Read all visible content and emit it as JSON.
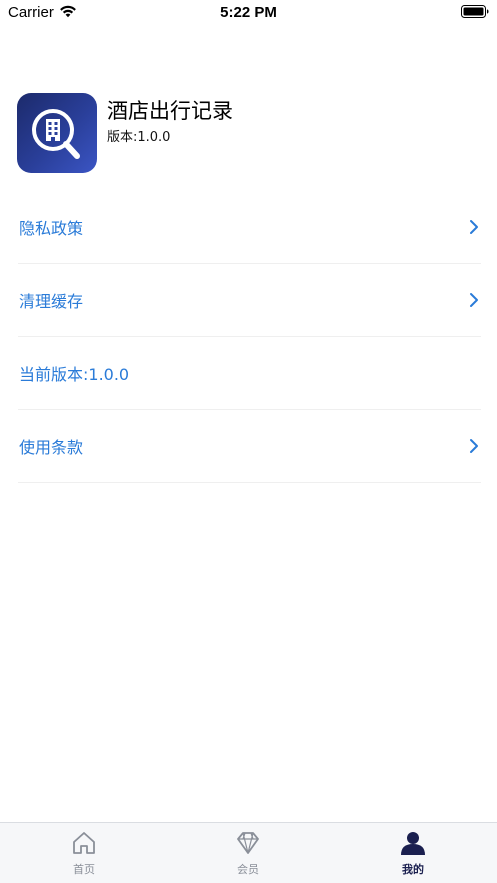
{
  "status_bar": {
    "carrier": "Carrier",
    "time": "5:22 PM"
  },
  "app": {
    "name": "酒店出行记录",
    "version": "版本:1.0.0",
    "logo_icon": "building-magnifier-icon"
  },
  "menu": {
    "items": [
      {
        "label": "隐私政策",
        "has_chevron": true
      },
      {
        "label": "清理缓存",
        "has_chevron": true
      },
      {
        "label": "当前版本:1.0.0",
        "has_chevron": false
      },
      {
        "label": "使用条款",
        "has_chevron": true
      }
    ]
  },
  "tab_bar": {
    "tabs": [
      {
        "label": "首页",
        "icon": "home-icon",
        "active": false
      },
      {
        "label": "会员",
        "icon": "diamond-icon",
        "active": false
      },
      {
        "label": "我的",
        "icon": "person-icon",
        "active": true
      }
    ]
  },
  "colors": {
    "accent": "#2a7bd8",
    "active_tab": "#1a1f4f",
    "inactive_tab": "#8a8f99",
    "logo_gradient_start": "#1c2a6b",
    "logo_gradient_end": "#3b55c4"
  }
}
